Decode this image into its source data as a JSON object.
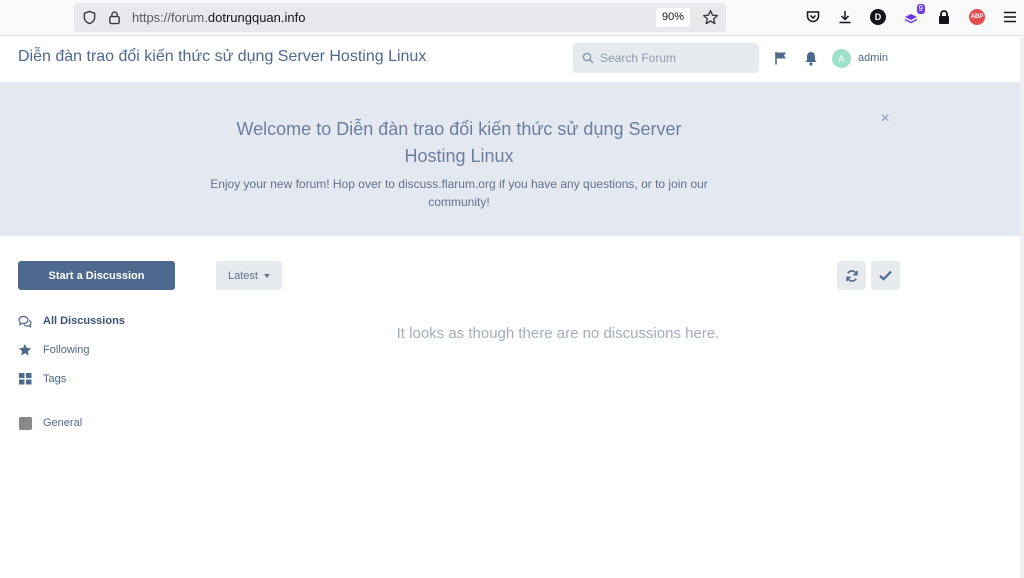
{
  "browser": {
    "url_prefix": "https://forum.",
    "url_domain": "dotrungquan.info",
    "zoom": "90%",
    "extension_d_label": "D",
    "extension_badge": "9",
    "abp_label": "ABP"
  },
  "header": {
    "title": "Diễn đàn trao đổi kiến thức sử dụng Server Hosting Linux",
    "search_placeholder": "Search Forum",
    "avatar_letter": "A",
    "username": "admin"
  },
  "hero": {
    "title": "Welcome to Diễn đàn trao đổi kiến thức sử dụng Server Hosting Linux",
    "text": "Enjoy your new forum! Hop over to discuss.flarum.org if you have any questions, or to join our community!",
    "close": "×"
  },
  "sidebar": {
    "start_button": "Start a Discussion",
    "items": [
      {
        "label": "All Discussions",
        "icon": "comments-icon"
      },
      {
        "label": "Following",
        "icon": "star-icon"
      },
      {
        "label": "Tags",
        "icon": "grid-icon"
      },
      {
        "label": "General",
        "icon": "tag-square-icon",
        "color": "#888888"
      }
    ]
  },
  "toolbar": {
    "sort_label": "Latest"
  },
  "main": {
    "empty_message": "It looks as though there are no discussions here."
  },
  "colors": {
    "primary": "#4d698e",
    "hero_bg": "#e4e9f1"
  }
}
